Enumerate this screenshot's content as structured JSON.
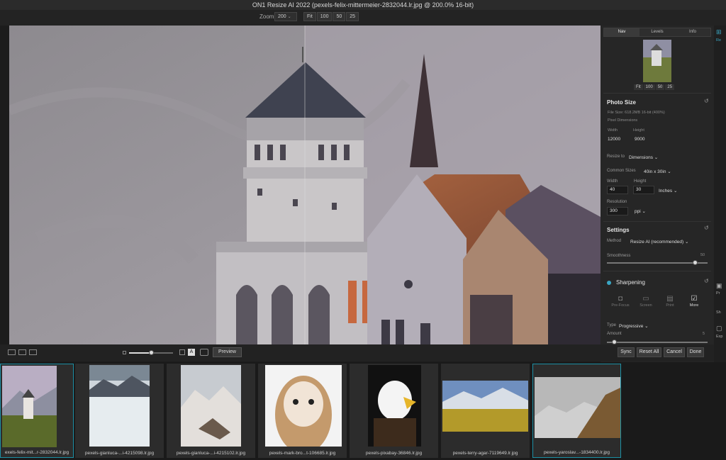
{
  "window": {
    "title": "ON1 Resize AI 2022 (pexels-felix-mittermeier-2832044.lr.jpg @ 200.0% 16-bit)"
  },
  "zoom": {
    "label": "Zoom",
    "value": "200",
    "presets": [
      "Fit",
      "100",
      "50",
      "25"
    ]
  },
  "panel": {
    "tabs": [
      "Nav",
      "Levels",
      "Info"
    ],
    "nav_presets": [
      "Fit",
      "100",
      "50",
      "25"
    ],
    "photo_size": {
      "title": "Photo Size",
      "file_size": "File Size: 618.2MB 16-bit (400%)",
      "pixel_dimensions": "Pixel Dimensions",
      "width_label": "Width",
      "width_value": "12000",
      "height_label": "Height",
      "height_value": "9000",
      "resize_to_label": "Resize to",
      "resize_to_value": "Dimensions",
      "common_sizes_label": "Common Sizes",
      "common_sizes_value": "40in x 30in",
      "w_label": "Width",
      "w_value": "40",
      "h_label": "Height",
      "h_value": "30",
      "unit": "Inches",
      "resolution_label": "Resolution",
      "resolution_value": "300",
      "resolution_unit": "ppi"
    },
    "settings": {
      "title": "Settings",
      "method_label": "Method",
      "method_value": "Resize AI (recommended)",
      "smoothness_label": "Smoothness",
      "smoothness_value": "50"
    },
    "sharpening": {
      "title": "Sharpening",
      "options": [
        "Pre-Focus",
        "Screen",
        "Print",
        "More"
      ],
      "type_label": "Type",
      "type_value": "Progressive",
      "amount_label": "Amount",
      "amount_value": "5"
    }
  },
  "far_right": {
    "items": [
      "Re",
      "Pr",
      "Sh",
      "Exp"
    ]
  },
  "bottom": {
    "preview": "Preview",
    "sync": "Sync",
    "reset_all": "Reset All",
    "cancel": "Cancel",
    "done": "Done"
  },
  "filmstrip": [
    "exels-felix-mit...r-2832044.lr.jpg",
    "pexels-gianluca-...i-4215098.lr.jpg",
    "pexels-gianluca-...i-4215102.lr.jpg",
    "pexels-mark-bro...t-106685.lr.jpg",
    "pexels-pixabay-36846.lr.jpg",
    "pexels-terry-agar-7119649.lr.jpg",
    "pexels-yaroslav...-1834400.lr.jpg"
  ],
  "colors": {
    "accent": "#1c8fa4",
    "panel_bg": "#262626",
    "app_bg": "#1c1c1c"
  }
}
